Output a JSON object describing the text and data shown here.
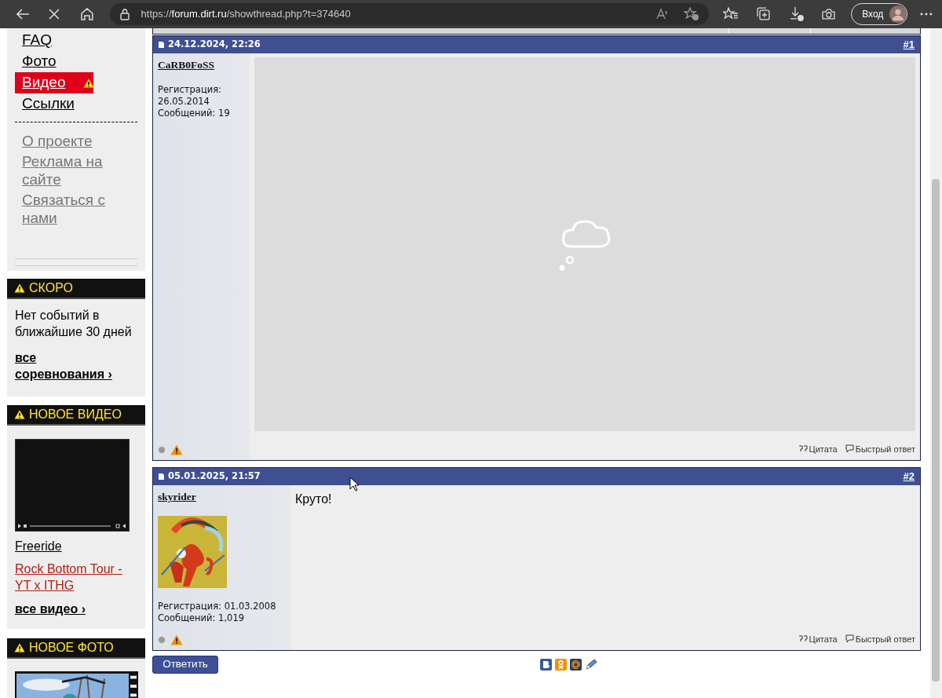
{
  "browser": {
    "url": "https://**forum.dirt.ru**/showthread.php?t=374640",
    "signin": "Вход"
  },
  "sidebar": {
    "nav": [
      {
        "label": "FAQ",
        "kind": "main",
        "highlighted": false
      },
      {
        "label": "Фото",
        "kind": "main",
        "highlighted": false
      },
      {
        "label": "Видео",
        "kind": "main",
        "highlighted": true
      },
      {
        "label": "Ссылки",
        "kind": "main",
        "highlighted": false
      },
      {
        "label": "О проекте",
        "kind": "secondary",
        "highlighted": false
      },
      {
        "label": "Реклама на сайте",
        "kind": "secondary",
        "highlighted": false
      },
      {
        "label": "Связаться с нами",
        "kind": "secondary",
        "highlighted": false
      }
    ],
    "soon": {
      "title": "СКОРО",
      "text": "Нет событий в ближайшие 30 дней",
      "link": "все соревнования ›"
    },
    "new_video": {
      "title": "НОВОЕ ВИДЕО",
      "links": [
        {
          "label": "Freeride",
          "kind": "plain"
        },
        {
          "label": "Rock Bottom Tour - YT x ITHG",
          "kind": "red"
        }
      ],
      "more": "все видео ›"
    },
    "new_photo": {
      "title": "НОВОЕ ФОТО"
    }
  },
  "posts": [
    {
      "date": "24.12.2024, 22:26",
      "number": "#1",
      "author": "CaRB0FoSS",
      "avatar": false,
      "reg": "Регистрация: 26.05.2014",
      "count": "Сообщений: 19",
      "quote": "Цитата",
      "quick_reply": "Быстрый ответ"
    },
    {
      "date": "05.01.2025, 21:57",
      "number": "#2",
      "author": "skyrider",
      "avatar": true,
      "reg": "Регистрация: 01.03.2008",
      "count": "Сообщений: 1,019",
      "kind": "text",
      "text": "Круто!",
      "quote": "Цитата",
      "quick_reply": "Быстрый ответ"
    }
  ],
  "reply_button": "Ответить"
}
